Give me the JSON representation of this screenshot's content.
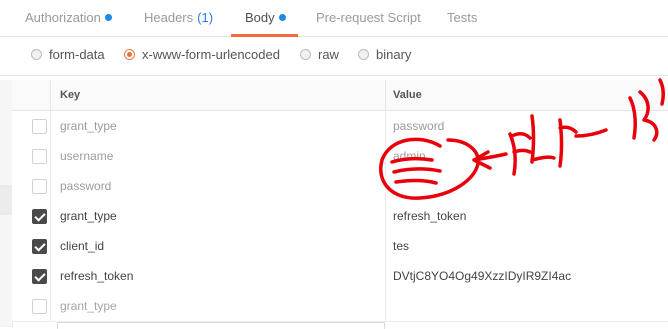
{
  "tabs": [
    {
      "label": "Authorization",
      "dot": true
    },
    {
      "label": "Headers",
      "count": "(1)"
    },
    {
      "label": "Body",
      "dot": true,
      "active": true
    },
    {
      "label": "Pre-request Script"
    },
    {
      "label": "Tests"
    }
  ],
  "body_types": [
    {
      "label": "form-data",
      "checked": false
    },
    {
      "label": "x-www-form-urlencoded",
      "checked": true
    },
    {
      "label": "raw",
      "checked": false
    },
    {
      "label": "binary",
      "checked": false
    }
  ],
  "table": {
    "key_header": "Key",
    "value_header": "Value",
    "rows": [
      {
        "key": "grant_type",
        "value": "password",
        "enabled": false
      },
      {
        "key": "username",
        "value": "admin",
        "enabled": false
      },
      {
        "key": "password",
        "value": "",
        "enabled": false
      },
      {
        "key": "grant_type",
        "value": "refresh_token",
        "enabled": true
      },
      {
        "key": "client_id",
        "value": "tes",
        "enabled": true
      },
      {
        "key": "refresh_token",
        "value": "DVtjC8YO4Og49XzzIDyIR9ZI4ac",
        "enabled": true
      }
    ],
    "new_row_placeholder": "grant_type"
  },
  "annotation_color": "#e8000b",
  "accent_color": "#f26b3a",
  "dot_color": "#1e88e5"
}
